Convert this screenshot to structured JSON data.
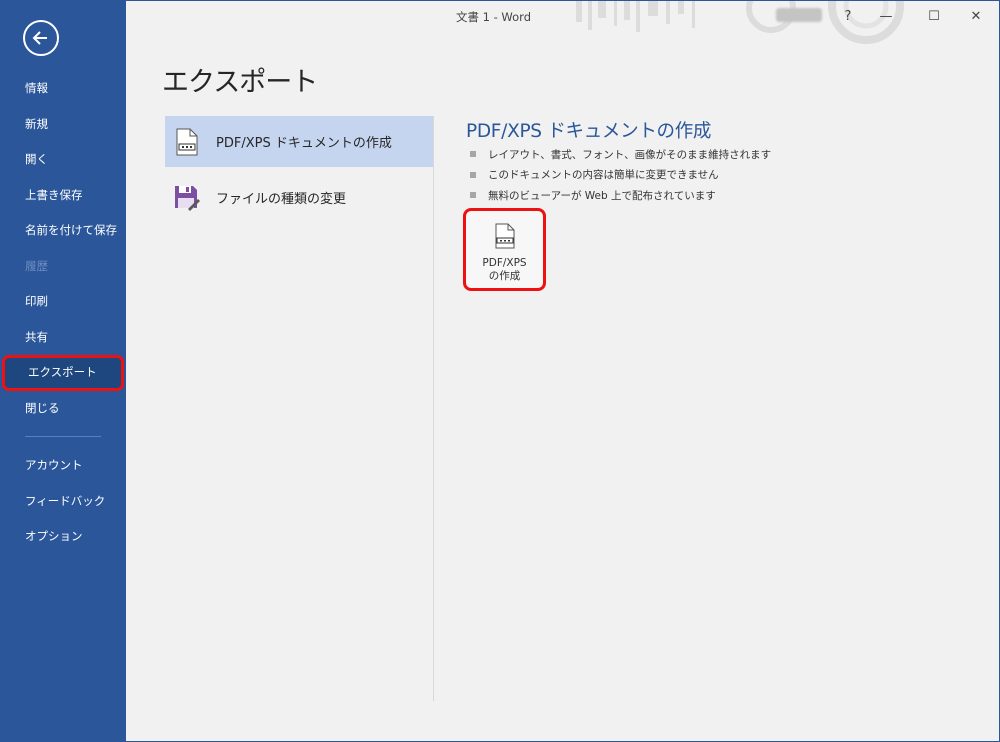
{
  "window": {
    "title": "文書 1  -  Word",
    "help_label": "?",
    "minimize_label": "—",
    "maximize_label": "☐",
    "close_label": "✕"
  },
  "sidebar": {
    "back_icon": "back-arrow-icon",
    "items": [
      {
        "label": "情報",
        "enabled": true
      },
      {
        "label": "新規",
        "enabled": true
      },
      {
        "label": "開く",
        "enabled": true
      },
      {
        "label": "上書き保存",
        "enabled": true
      },
      {
        "label": "名前を付けて保存",
        "enabled": true
      },
      {
        "label": "履歴",
        "enabled": false
      },
      {
        "label": "印刷",
        "enabled": true
      },
      {
        "label": "共有",
        "enabled": true
      },
      {
        "label": "エクスポート",
        "enabled": true,
        "selected": true
      },
      {
        "label": "閉じる",
        "enabled": true
      }
    ],
    "bottom_items": [
      {
        "label": "アカウント"
      },
      {
        "label": "フィードバック"
      },
      {
        "label": "オプション"
      }
    ]
  },
  "main": {
    "page_title": "エクスポート",
    "options": [
      {
        "label": "PDF/XPS ドキュメントの作成",
        "icon": "pdf-document-icon",
        "selected": true
      },
      {
        "label": "ファイルの種類の変更",
        "icon": "save-as-file-type-icon",
        "selected": false
      }
    ],
    "detail": {
      "title": "PDF/XPS ドキュメントの作成",
      "bullets": [
        "レイアウト、書式、フォント、画像がそのまま維持されます",
        "このドキュメントの内容は簡単に変更できません",
        "無料のビューアーが Web 上で配布されています"
      ],
      "button_line1": "PDF/XPS",
      "button_line2": "の作成"
    }
  },
  "colors": {
    "sidebar": "#2b579a",
    "sidebar_selected": "#1f477f",
    "highlight": "#ee1111",
    "option_selected": "#c5d5ef",
    "background": "#f1f1f1"
  }
}
